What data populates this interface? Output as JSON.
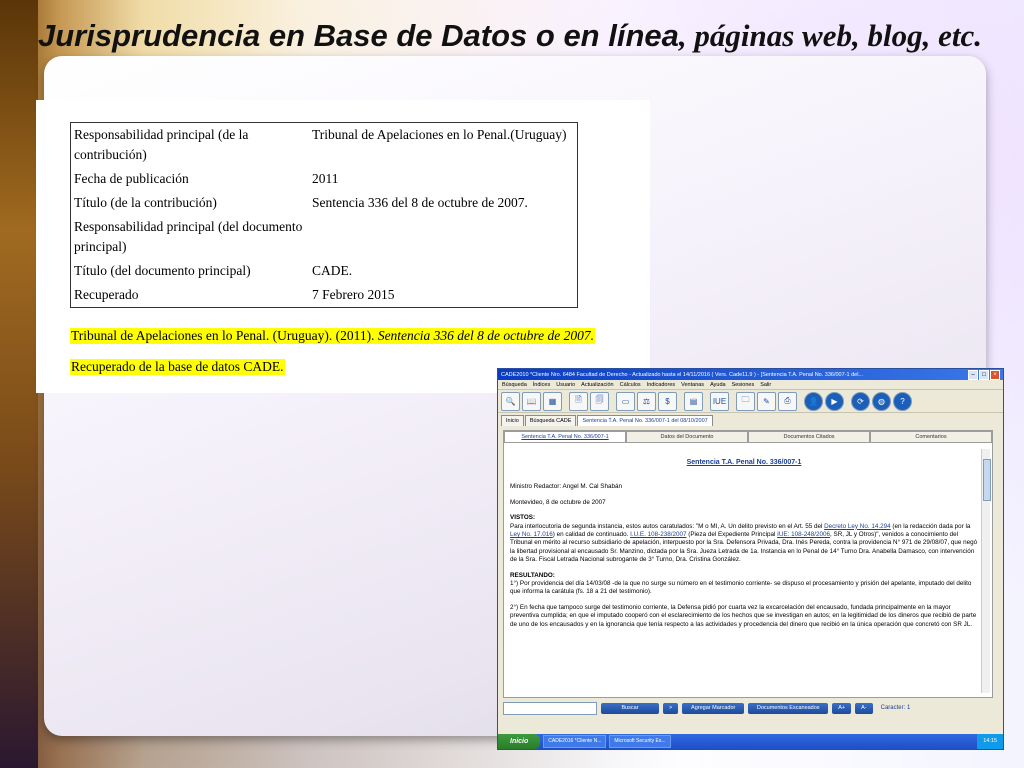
{
  "slide": {
    "title_sans": "Jurisprudencia en Base de Datos o en línea",
    "title_serif": ", páginas web, blog, etc."
  },
  "citation_table": [
    {
      "key": "Responsabilidad principal (de la contribución)",
      "value": "Tribunal de Apelaciones en lo Penal.(Uruguay)"
    },
    {
      "key": "Fecha de publicación",
      "value": "2011"
    },
    {
      "key": "Título (de la contribución)",
      "value": "Sentencia 336 del 8 de octubre de 2007."
    },
    {
      "key": "Responsabilidad principal (del documento principal)",
      "value": ""
    },
    {
      "key": "Título (del documento principal)",
      "value": "CADE."
    },
    {
      "key": "Recuperado",
      "value": "7 Febrero 2015"
    }
  ],
  "reference": {
    "line1_plain": "Tribunal de Apelaciones en lo Penal. (Uruguay). (2011). ",
    "line1_italic": "Sentencia 336 del 8 de octubre de 2007.",
    "line2": "Recuperado de la base de datos CADE."
  },
  "app": {
    "window_title": "CADE2010 *Cliente Nro. 6484 Facultad de Derecho - Actualizado hasta el 14/11/2016 ( Vers. Cade11.9 ) - [Sentencia T.A. Penal No. 336/007-1 del...",
    "menu": [
      "Búsqueda",
      "Índices",
      "Usuario",
      "Actualización",
      "Cálculos",
      "Indicadores",
      "Ventanas",
      "Ayuda",
      "Sesiones",
      "Salir"
    ],
    "toolbar_icons": [
      {
        "name": "search-icon",
        "glyph": "🔍"
      },
      {
        "name": "book-icon",
        "glyph": "📖"
      },
      {
        "name": "cade-icon",
        "glyph": "▦"
      },
      {
        "name": "document-icon",
        "glyph": "🗎"
      },
      {
        "name": "page-icon",
        "glyph": "🗐"
      },
      {
        "name": "id-card-icon",
        "glyph": "▭"
      },
      {
        "name": "scales-icon",
        "glyph": "⚖"
      },
      {
        "name": "money-icon",
        "glyph": "$"
      },
      {
        "name": "calculator-icon",
        "glyph": "▤"
      },
      {
        "name": "iue-icon",
        "glyph": "IUE"
      },
      {
        "name": "folder-icon",
        "glyph": "🗀"
      },
      {
        "name": "pen-icon",
        "glyph": "✎"
      },
      {
        "name": "print-icon",
        "glyph": "⎙"
      },
      {
        "name": "cade-user-icon",
        "glyph": "👤"
      },
      {
        "name": "play-icon",
        "glyph": "▶"
      },
      {
        "name": "refresh-icon",
        "glyph": "⟳"
      },
      {
        "name": "globe-icon",
        "glyph": "◍"
      },
      {
        "name": "help-icon",
        "glyph": "?"
      }
    ],
    "doc_tabs": [
      "Inicio",
      "Búsqueda CADE",
      "Sentencia T.A. Penal No. 336/007-1 del 08/10/2007"
    ],
    "sub_tabs": [
      "Sentencia T.A. Penal No. 336/007-1",
      "Datos del Documento",
      "Documentos Citados",
      "Comentarios"
    ],
    "doc": {
      "heading": "Sentencia T.A. Penal No. 336/007-1",
      "minister": "Ministro Redactor: Angel M. Cal Shabán",
      "date": "Montevideo, 8 de octubre de 2007",
      "vistos_label": "VISTOS:",
      "vistos_p1": "Para interlocutoria de segunda instancia, estos autos caratulados: \"M o MI, A. Un delito previsto en el Art. 55 del ",
      "link1": "Decreto Ley No. 14.294",
      "vistos_p2": " (en la redacción dada por la ",
      "link2": "Ley No. 17.016",
      "vistos_p3": ") en calidad de continuado. ",
      "link3": "I.U.E. 108-238/2007",
      "vistos_p4": " (Pieza del Expediente Principal ",
      "link4": "IUE: 108-248/2006",
      "vistos_p5": ", SR, JL y Otros)\", venidos a conocimiento del Tribunal en mérito al recurso subsidiario de apelación, interpuesto por la Sra. Defensora Privada, Dra. Inés Pereda, contra la providencia N° 971 de 29/08/07, que negó la libertad provisional al encausado Sr. Manzino, dictada por la Sra. Jueza Letrada de 1a. Instancia en lo Penal de 14° Turno Dra. Anabella Damasco, con intervención de la Sra. Fiscal Letrada Nacional subrogante de 3° Turno, Dra. Cristina González.",
      "resultando_label": "RESULTANDO:",
      "res1": "1°) Por providencia del día 14/03/08 -de la que no surge su número en el testimonio corriente- se dispuso el procesamiento y prisión del apelante, imputado del delito que informa la carátula (fs. 18 a 21 del testimonio).",
      "res2": "2°) En fecha que tampoco surge del testimonio corriente, la Defensa pidió por cuarta vez la excarcelación del encausado, fundada principalmente en la mayor preventiva cumplida; en que el imputado cooperó con el esclarecimiento de los hechos que se investigan en autos; en la legitimidad de los dineros que recibió de parte de uno de los encausados y en la ignorancia que tenía respecto a las actividades y procedencia del dinero que recibió en la única operación que concretó con SR JL."
    },
    "buttons": {
      "buscar": "Buscar",
      "next": ">",
      "agregar": "Agregar Marcador",
      "escaneados": "Documentos Escaneados",
      "font_up": "A+",
      "font_down": "A-"
    },
    "char_label": "Caracter: 1",
    "taskbar": {
      "start": "Inicio",
      "items": [
        "CADE2016 *Cliente N...",
        "Microsoft Security Es..."
      ],
      "clock": "14:15"
    }
  }
}
